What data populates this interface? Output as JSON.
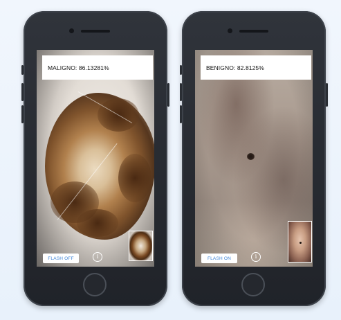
{
  "phones": [
    {
      "result_label": "MALIGNO: 86.13281%",
      "flash_label": "FLASH OFF",
      "info_glyph": "i",
      "image_subject": "lesion-macro"
    },
    {
      "result_label": "BENIGNO: 82.8125%",
      "flash_label": "FLASH ON",
      "info_glyph": "i",
      "image_subject": "skin-mole"
    }
  ],
  "colors": {
    "background": "#edf4fc",
    "phone_body": "#25282e",
    "label_bg": "#ffffff",
    "flash_text": "#3b82d6"
  },
  "icons": {
    "info": "info-circle-icon",
    "home": "home-button"
  }
}
